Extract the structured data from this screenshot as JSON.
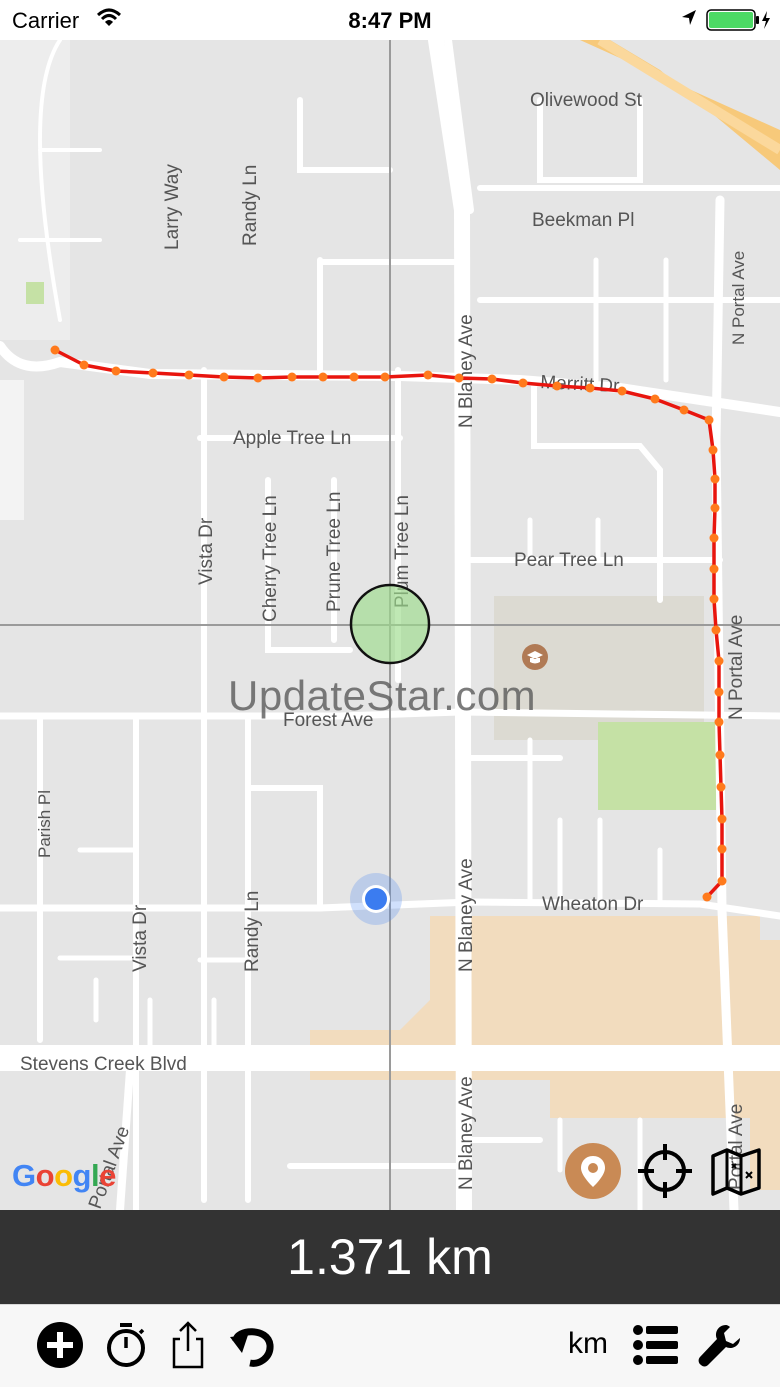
{
  "status_bar": {
    "carrier": "Carrier",
    "time": "8:47 PM"
  },
  "map": {
    "watermark": "UpdateStar.com",
    "provider_logo": "Google",
    "street_labels": {
      "olivewood_st": "Olivewood St",
      "beekman_pl": "Beekman Pl",
      "larry_way": "Larry Way",
      "randy_ln_top": "Randy Ln",
      "n_portal_ave_top": "N Portal Ave",
      "n_blaney_ave_top": "N Blaney Ave",
      "merritt_dr": "Merritt Dr",
      "apple_tree_ln": "Apple Tree Ln",
      "vista_dr_top": "Vista Dr",
      "cherry_tree_ln": "Cherry Tree Ln",
      "prune_tree_ln": "Prune Tree Ln",
      "plum_tree_ln": "Plum Tree Ln",
      "pear_tree_ln": "Pear Tree Ln",
      "n_portal_ave_mid": "N Portal Ave",
      "forest_ave": "Forest Ave",
      "parish_pl": "Parish Pl",
      "vista_dr_bottom": "Vista Dr",
      "randy_ln_bottom": "Randy Ln",
      "n_blaney_ave_mid": "N Blaney Ave",
      "wheaton_dr": "Wheaton Dr",
      "stevens_creek_blvd": "Stevens Creek Blvd",
      "portal_ave_bottom_left": "Portal Ave",
      "blaney_ave_bottom": "N Blaney Ave",
      "portal_ave_bottom_right": "Portal Ave"
    },
    "route_color": "#e8150e",
    "route_dot_color": "#ff7a1c",
    "icons": {
      "pin": "map-pin-icon",
      "locate": "crosshair-icon",
      "map_type": "folded-map-icon"
    },
    "pin_button_color": "#c98a55"
  },
  "distance": {
    "value": "1.371 km"
  },
  "toolbar": {
    "unit_label": "km",
    "icons": [
      "add-circle-icon",
      "stopwatch-icon",
      "share-icon",
      "undo-icon",
      "list-icon",
      "wrench-icon"
    ]
  }
}
